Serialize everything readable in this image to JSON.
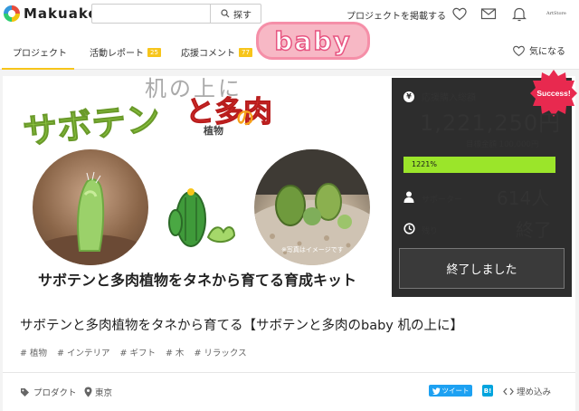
{
  "header": {
    "logo_text": "Makuake",
    "search_placeholder": "",
    "search_button": "探す",
    "post_link": "プロジェクトを掲載する",
    "artstore": "ArtStore"
  },
  "tabs": [
    {
      "label": "プロジェクト",
      "badge": ""
    },
    {
      "label": "活動レポート",
      "badge": "25"
    },
    {
      "label": "応援コメント",
      "badge": "77"
    }
  ],
  "favorite_label": "気になる",
  "hero": {
    "title_part1": "サボテン",
    "title_part2": "と多肉",
    "title_part3": "植物",
    "title_part4": "の",
    "title_baby": "baby",
    "title_desk": "机の上に",
    "photo_note": "※写真はイメージです",
    "caption": "サボテンと多肉植物をタネから育てる育成キット"
  },
  "panel": {
    "success_badge": "Success!",
    "amount_label": "応援購入総額",
    "yen_symbol": "¥",
    "amount": "1,221,250円",
    "goal": "目標金額 100,000円",
    "progress_text": "1221%",
    "progress_fraction": 1.0,
    "supporters_label": "サポーター",
    "supporters_value": "614人",
    "remaining_label": "残り",
    "remaining_value": "終了",
    "ended_button": "終了しました"
  },
  "project": {
    "title": "サボテンと多肉植物をタネから育てる【サボテンと多肉のbaby 机の上に】",
    "tags": [
      "# 植物",
      "# インテリア",
      "# ギフト",
      "# 木",
      "# リラックス"
    ],
    "category": "プロダクト",
    "location": "東京",
    "tweet": "ツイート",
    "hatena": "B!",
    "embed": "埋め込み"
  },
  "colors": {
    "accent": "#f7c51b",
    "panel_bg": "#2d2d2d",
    "progress": "#9be52a",
    "success": "#e8294f"
  }
}
